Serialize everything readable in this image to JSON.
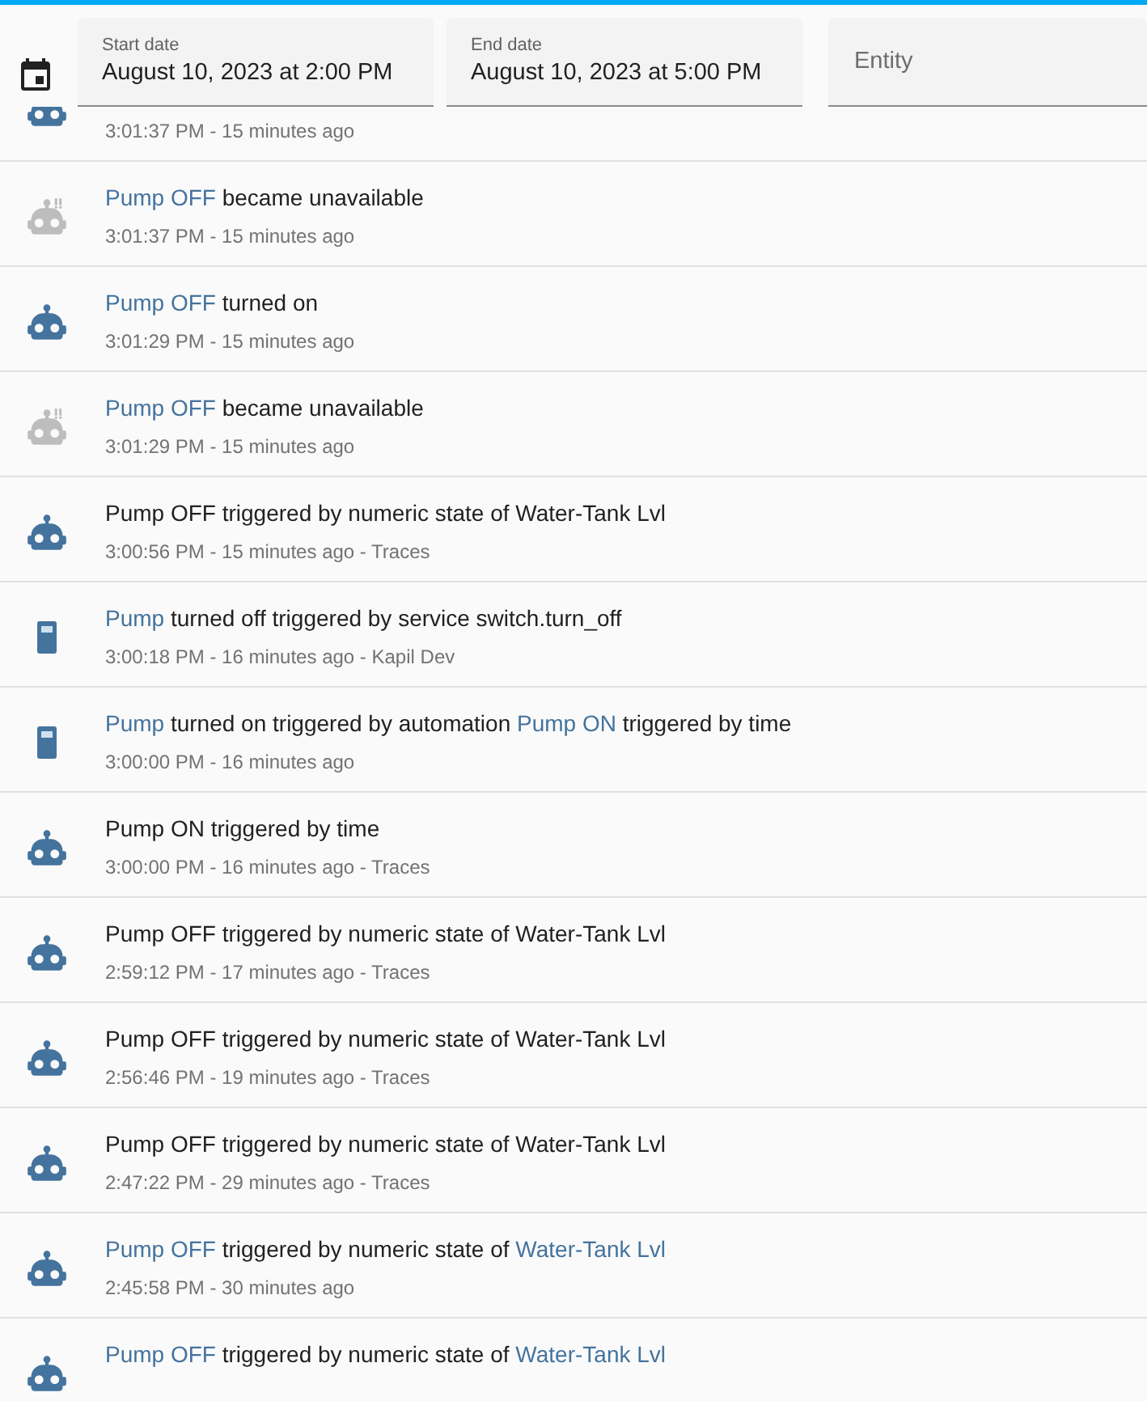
{
  "filters": {
    "start_date": {
      "label": "Start date",
      "value": "August 10, 2023 at 2:00 PM"
    },
    "end_date": {
      "label": "End date",
      "value": "August 10, 2023 at 5:00 PM"
    },
    "entity": {
      "placeholder": "Entity"
    }
  },
  "entries": [
    {
      "kind": "robot",
      "unavailable": false,
      "time": "3:01:37 PM - 15 minutes ago"
    },
    {
      "kind": "robot",
      "unavailable": true,
      "parts": [
        {
          "text": "Pump OFF",
          "link": true
        },
        {
          "text": " became unavailable",
          "link": false
        }
      ],
      "time": "3:01:37 PM - 15 minutes ago"
    },
    {
      "kind": "robot",
      "unavailable": false,
      "parts": [
        {
          "text": "Pump OFF",
          "link": true
        },
        {
          "text": " turned on",
          "link": false
        }
      ],
      "time": "3:01:29 PM - 15 minutes ago"
    },
    {
      "kind": "robot",
      "unavailable": true,
      "parts": [
        {
          "text": "Pump OFF",
          "link": true
        },
        {
          "text": " became unavailable",
          "link": false
        }
      ],
      "time": "3:01:29 PM - 15 minutes ago"
    },
    {
      "kind": "robot",
      "unavailable": false,
      "parts": [
        {
          "text": "Pump OFF triggered by numeric state of Water-Tank Lvl",
          "link": false
        }
      ],
      "time": "3:00:56 PM - 15 minutes ago - Traces"
    },
    {
      "kind": "switch",
      "unavailable": false,
      "parts": [
        {
          "text": "Pump",
          "link": true
        },
        {
          "text": " turned off triggered by service switch.turn_off",
          "link": false
        }
      ],
      "time": "3:00:18 PM - 16 minutes ago - Kapil Dev"
    },
    {
      "kind": "switch",
      "unavailable": false,
      "parts": [
        {
          "text": "Pump",
          "link": true
        },
        {
          "text": " turned on triggered by automation ",
          "link": false
        },
        {
          "text": "Pump ON",
          "link": true
        },
        {
          "text": " triggered by time",
          "link": false
        }
      ],
      "time": "3:00:00 PM - 16 minutes ago"
    },
    {
      "kind": "robot",
      "unavailable": false,
      "parts": [
        {
          "text": "Pump ON triggered by time",
          "link": false
        }
      ],
      "time": "3:00:00 PM - 16 minutes ago - Traces"
    },
    {
      "kind": "robot",
      "unavailable": false,
      "parts": [
        {
          "text": "Pump OFF triggered by numeric state of Water-Tank Lvl",
          "link": false
        }
      ],
      "time": "2:59:12 PM - 17 minutes ago - Traces"
    },
    {
      "kind": "robot",
      "unavailable": false,
      "parts": [
        {
          "text": "Pump OFF triggered by numeric state of Water-Tank Lvl",
          "link": false
        }
      ],
      "time": "2:56:46 PM - 19 minutes ago - Traces"
    },
    {
      "kind": "robot",
      "unavailable": false,
      "parts": [
        {
          "text": "Pump OFF triggered by numeric state of Water-Tank Lvl",
          "link": false
        }
      ],
      "time": "2:47:22 PM - 29 minutes ago - Traces"
    },
    {
      "kind": "robot",
      "unavailable": false,
      "parts": [
        {
          "text": "Pump OFF",
          "link": true
        },
        {
          "text": " triggered by numeric state of ",
          "link": false
        },
        {
          "text": "Water-Tank Lvl",
          "link": true
        }
      ],
      "time": "2:45:58 PM - 30 minutes ago"
    },
    {
      "kind": "robot",
      "unavailable": false,
      "parts": [
        {
          "text": "Pump OFF",
          "link": true
        },
        {
          "text": " triggered by numeric state of ",
          "link": false
        },
        {
          "text": "Water-Tank Lvl",
          "link": true
        }
      ]
    }
  ]
}
